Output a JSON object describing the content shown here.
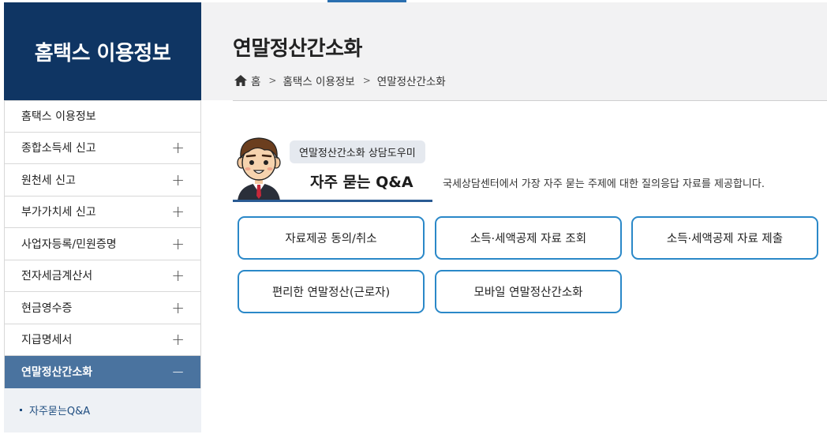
{
  "sidebar": {
    "title": "홈택스 이용정보",
    "items": [
      {
        "label": "홈택스 이용정보",
        "expand": ""
      },
      {
        "label": "종합소득세 신고",
        "expand": "+"
      },
      {
        "label": "원천세 신고",
        "expand": "+"
      },
      {
        "label": "부가가치세 신고",
        "expand": "+"
      },
      {
        "label": "사업자등록/민원증명",
        "expand": "+"
      },
      {
        "label": "전자세금계산서",
        "expand": "+"
      },
      {
        "label": "현금영수증",
        "expand": "+"
      },
      {
        "label": "지급명세서",
        "expand": "+"
      },
      {
        "label": "연말정산간소화",
        "expand": "−"
      }
    ],
    "sub_items": [
      {
        "label": "자주묻는Q&A"
      }
    ]
  },
  "header": {
    "title": "연말정산간소화",
    "breadcrumb": [
      "홈",
      "홈택스 이용정보",
      "연말정산간소화"
    ],
    "separator": ">"
  },
  "qna": {
    "badge": "연말정산간소화 상담도우미",
    "title": "자주 묻는 Q&A",
    "description": "국세상담센터에서 가장 자주 묻는 주제에 대한 질의응답 자료를 제공합니다."
  },
  "buttons": [
    {
      "label": "자료제공 동의/취소"
    },
    {
      "label": "소득·세액공제 자료 조회"
    },
    {
      "label": "소득·세액공제 자료 제출"
    },
    {
      "label": "편리한 연말정산(근로자)"
    },
    {
      "label": "모바일 연말정산간소화"
    }
  ],
  "colors": {
    "sidebar_head": "#0f3563",
    "active_item": "#4a739f",
    "button_border": "#2a88c8",
    "header_bg": "#f2f2f3"
  }
}
